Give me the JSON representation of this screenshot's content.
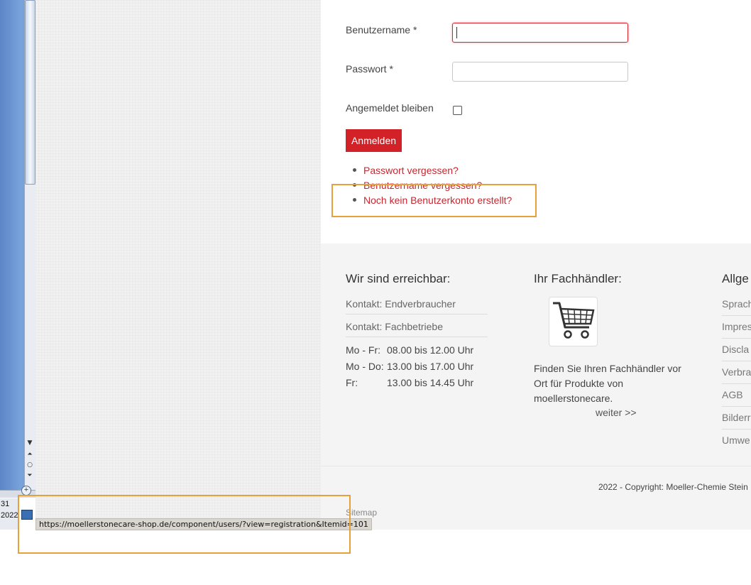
{
  "login": {
    "username_label": "Benutzername *",
    "password_label": "Passwort *",
    "remember_label": "Angemeldet bleiben",
    "submit_label": "Anmelden",
    "links": [
      "Passwort vergessen?",
      "Benutzername vergessen?",
      "Noch kein Benutzerkonto erstellt?"
    ]
  },
  "footer": {
    "col1": {
      "title": "Wir sind erreichbar:",
      "contact1_prefix": "Kontakt:",
      "contact1_value": "Endverbraucher",
      "contact2_prefix": "Kontakt:",
      "contact2_value": "Fachbetriebe",
      "hours": [
        {
          "day": "Mo - Fr:",
          "time": "08.00 bis 12.00 Uhr"
        },
        {
          "day": "Mo - Do:",
          "time": "13.00 bis 17.00 Uhr"
        },
        {
          "day": "Fr:",
          "time": "13.00 bis 14.45 Uhr"
        }
      ]
    },
    "col2": {
      "title": "Ihr Fachhändler:",
      "icon": "shopping-cart-icon",
      "text": "Finden Sie Ihren Fachhändler vor Ort für Produkte von moellerstonecare.",
      "more": "weiter >>"
    },
    "col3": {
      "title": "Allge",
      "items": [
        "Sprach",
        "Impres",
        "Discla",
        "Verbra",
        "AGB",
        "Bilderr",
        "Umwe"
      ]
    },
    "copyright": "2022 - Copyright: Moeller-Chemie Stein",
    "sitemap": "Sitemap"
  },
  "status_url": "https://moellerstonecare-shop.de/component/users/?view=registration&Itemid=101",
  "taskbar": {
    "clock_line1": "31",
    "clock_line2": "2022"
  },
  "colors": {
    "accent": "#d32128",
    "link": "#c9262f",
    "highlight": "#e8a13a"
  }
}
